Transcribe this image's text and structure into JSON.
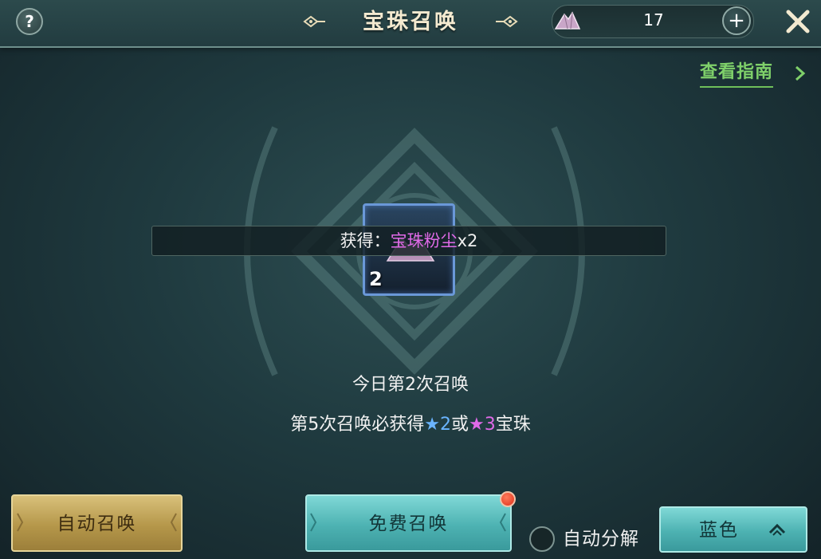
{
  "header": {
    "help_label": "?",
    "title": "宝珠召唤",
    "currency": {
      "icon": "crystal-dust-icon",
      "value": "17"
    },
    "plus_label": "+",
    "close_icon": "close-icon"
  },
  "guide": {
    "label": "查看指南"
  },
  "slot": {
    "icon": "crystal-dust-icon",
    "count": "2"
  },
  "reward": {
    "prefix": "获得：",
    "item": "宝珠粉尘",
    "qty": "x2"
  },
  "info": {
    "today": "今日第2次召唤",
    "guarantee_prefix": "第5次召唤必获得",
    "star": "★",
    "tier1": "2",
    "joiner": "或",
    "tier2": "3",
    "suffix": "宝珠"
  },
  "buttons": {
    "auto_summon": "自动召唤",
    "free_summon": "免费召唤",
    "auto_decompose": "自动分解",
    "color_select": "蓝色"
  },
  "colors": {
    "reward_item": "#e06ae8",
    "star_blue": "#6ab4ff",
    "star_pink": "#e06ae8",
    "guide": "#7fd06a"
  }
}
